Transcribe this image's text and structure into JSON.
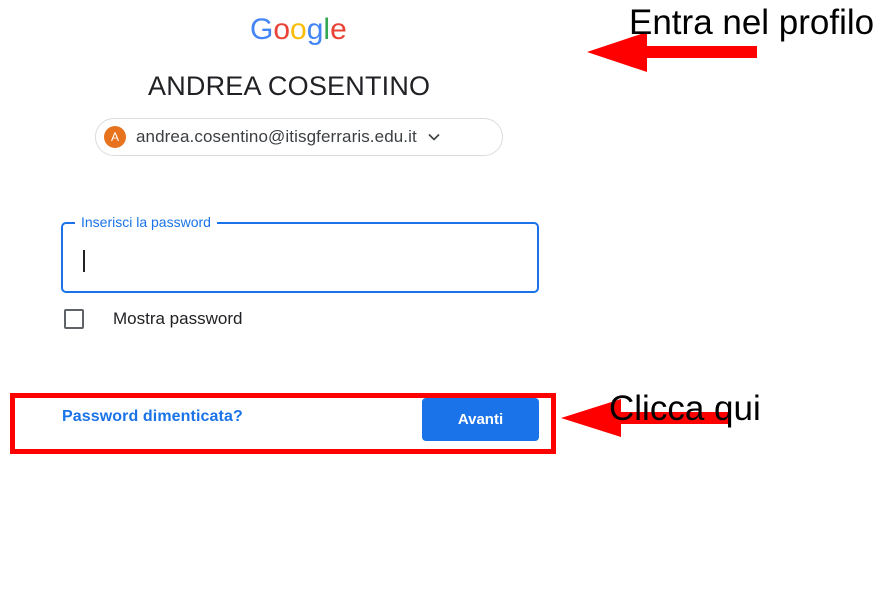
{
  "logo": {
    "letters": [
      "G",
      "o",
      "o",
      "g",
      "l",
      "e"
    ],
    "colors": [
      "#4285F4",
      "#EA4335",
      "#FBBC05",
      "#4285F4",
      "#34A853",
      "#EA4335"
    ]
  },
  "account": {
    "name": "ANDREA COSENTINO",
    "avatar_letter": "A",
    "email": "andrea.cosentino@itisgferraris.edu.it"
  },
  "password": {
    "label": "Inserisci la password",
    "value": ""
  },
  "show_password": {
    "label": "Mostra password",
    "checked": false
  },
  "actions": {
    "forgot_label": "Password dimenticata?",
    "next_label": "Avanti"
  },
  "annotations": {
    "top_label": "Entra nel profilo",
    "bottom_label": "Clicca qui"
  },
  "colors": {
    "accent": "#1a73e8",
    "annotation": "#ff0000",
    "avatar": "#e8731f"
  },
  "icons": {
    "chip_chevron": "chevron-down-icon",
    "annotation_arrow": "arrow-left-icon"
  }
}
